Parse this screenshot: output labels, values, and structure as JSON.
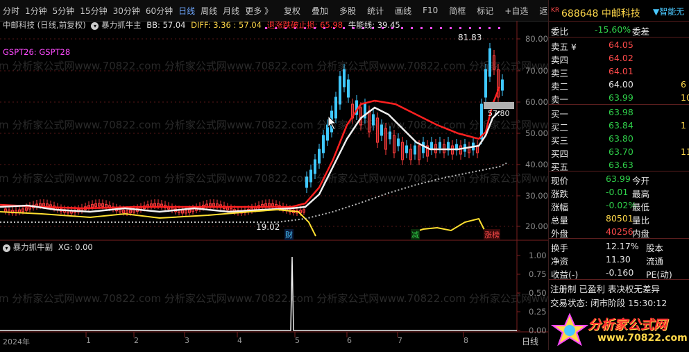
{
  "toolbar": {
    "left_items": [
      "分时",
      "1分钟",
      "5分钟",
      "15分钟",
      "30分钟",
      "60分钟",
      "日线",
      "周线",
      "月线",
      "更多 》"
    ],
    "active": "日线",
    "right_items": [
      "复权",
      "叠加",
      "多股",
      "统计",
      "画线",
      "F10",
      "简框",
      "标记",
      "+自选",
      "返回"
    ]
  },
  "chart": {
    "stock_title": "中邮科技 (日线,前复权)",
    "indicator_main": "暴力抓牛主",
    "bb_label": "BB: 57.04",
    "diff_label": "DIFF: 3.36 : 57.04",
    "stop_label": "退涨跌破止损: 65.98",
    "bull_label": "牛能线: 39.45",
    "gspt_label": "GSPT26: GSPT28",
    "high_label": "81.83",
    "low_label": "19.02",
    "price_tag": "57.80",
    "y_axis_main": [
      "80.00",
      "70.00",
      "60.00",
      "50.00",
      "40.00",
      "30.00",
      "20.00"
    ],
    "markers": [
      "财",
      "减",
      "涨榜"
    ],
    "sub_indicator": "暴力抓牛副",
    "xg_label": "XG: 0.00",
    "y_axis_sub": [
      "1.00",
      "0.75",
      "0.50",
      "0.25",
      "0.00"
    ],
    "x_axis": [
      "2024年",
      "1",
      "2",
      "3",
      "4",
      "5",
      "6",
      "7",
      "8"
    ],
    "period_label": "日线",
    "watermark": "m 分析家公式网www.70822.com 分析家公式网www.70822.com 分析家公式网www.70822.com 分析家公式网www.70822.com"
  },
  "quote": {
    "kr": "KR",
    "code_name": "688648 中邮科技",
    "smart": "▼智能无",
    "weibi_label": "委比",
    "weibi_val": "-15.60%",
    "weicha_label": "委差",
    "asks": [
      {
        "label": "卖五 ¥",
        "price": "64.05",
        "vol": ""
      },
      {
        "label": "卖四",
        "price": "64.02",
        "vol": ""
      },
      {
        "label": "卖三",
        "price": "64.01",
        "vol": ""
      },
      {
        "label": "卖二",
        "price": "64.00",
        "vol": "6"
      },
      {
        "label": "卖一",
        "price": "63.99",
        "vol": "10"
      }
    ],
    "bids": [
      {
        "label": "买一",
        "price": "63.98",
        "vol": ""
      },
      {
        "label": "买二",
        "price": "63.84",
        "vol": "1"
      },
      {
        "label": "买三",
        "price": "63.80",
        "vol": ""
      },
      {
        "label": "买四",
        "price": "63.70",
        "vol": "11"
      },
      {
        "label": "买五",
        "price": "63.63",
        "vol": ""
      }
    ],
    "stats": [
      {
        "l": "现价",
        "v": "63.99",
        "v_color": "green",
        "r": "今开"
      },
      {
        "l": "涨跌",
        "v": "-0.01",
        "v_color": "green",
        "r": "最高"
      },
      {
        "l": "涨幅",
        "v": "-0.02%",
        "v_color": "green",
        "r": "最低"
      },
      {
        "l": "总量",
        "v": "80501",
        "v_color": "yellow",
        "r": "量比"
      },
      {
        "l": "外盘",
        "v": "40256",
        "v_color": "red",
        "r": "内盘"
      }
    ],
    "stats2": [
      {
        "l": "换手",
        "v": "12.17%",
        "r": "股本"
      },
      {
        "l": "净资",
        "v": "11.30",
        "r": "流通"
      },
      {
        "l": "收益(-)",
        "v": "-0.160",
        "r": "PE(动)"
      }
    ],
    "reg": "注册制 已盈利 表决权无差异",
    "status": "交易状态: 闭市阶段 15:30:12",
    "logo_text": "分析家公式网",
    "logo_url": "www.70822.com"
  }
}
